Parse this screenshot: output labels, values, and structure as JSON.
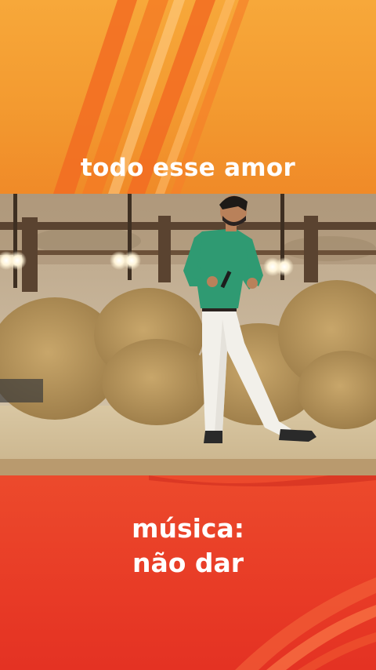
{
  "captions": {
    "top": "todo esse amor",
    "bottom_line1": "música:",
    "bottom_line2": "não dar"
  },
  "colors": {
    "top_band": "#f39a30",
    "bottom_band": "#e83b26",
    "caption_text": "#ffffff",
    "shirt": "#2f9a72",
    "pants": "#f2f0ea"
  },
  "video": {
    "subject": "performer-singing",
    "icons": [
      "microphone-icon"
    ]
  }
}
